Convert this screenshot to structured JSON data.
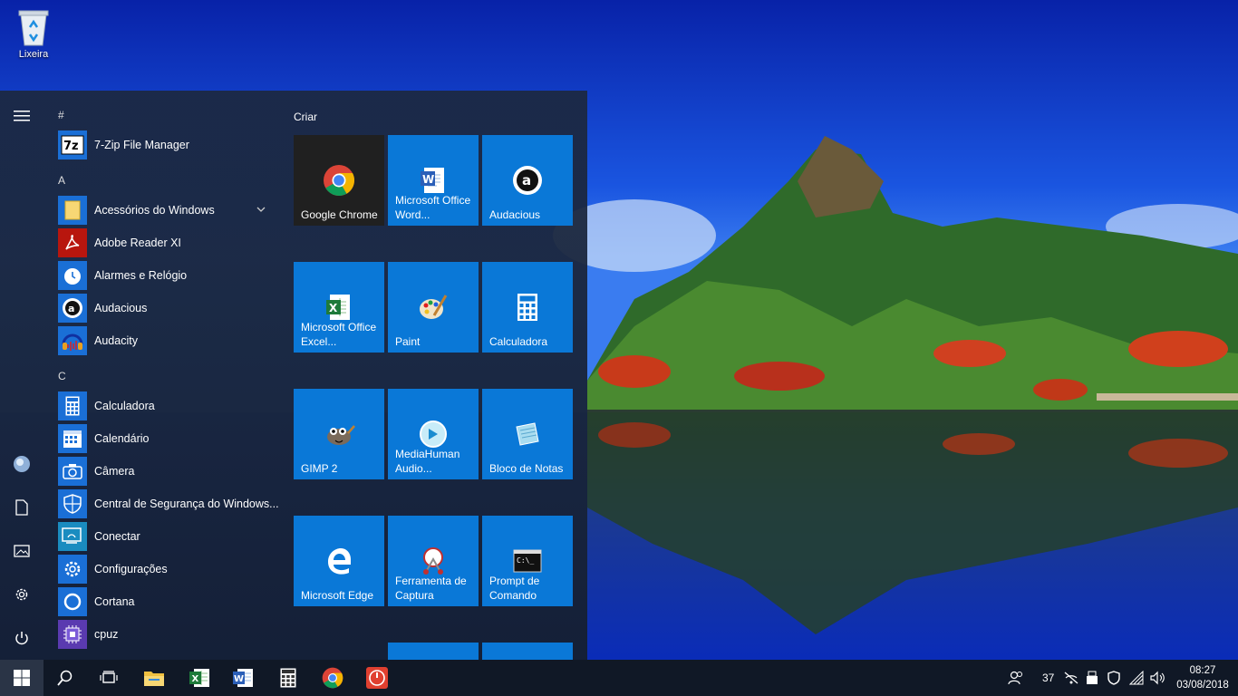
{
  "desktop": {
    "recycle_bin_label": "Lixeira"
  },
  "start_menu": {
    "tiles_header": "Criar",
    "app_list": [
      {
        "type": "group",
        "label": "#"
      },
      {
        "type": "app",
        "label": "7-Zip File Manager",
        "icon": "sevenzip-icon"
      },
      {
        "type": "group",
        "label": "A"
      },
      {
        "type": "app",
        "label": "Acessórios do Windows",
        "icon": "folder-icon",
        "expandable": true
      },
      {
        "type": "app",
        "label": "Adobe Reader XI",
        "icon": "adobe-reader-icon"
      },
      {
        "type": "app",
        "label": "Alarmes e Relógio",
        "icon": "alarm-clock-icon"
      },
      {
        "type": "app",
        "label": "Audacious",
        "icon": "audacious-icon"
      },
      {
        "type": "app",
        "label": "Audacity",
        "icon": "audacity-icon"
      },
      {
        "type": "group",
        "label": "C"
      },
      {
        "type": "app",
        "label": "Calculadora",
        "icon": "calculator-icon"
      },
      {
        "type": "app",
        "label": "Calendário",
        "icon": "calendar-icon"
      },
      {
        "type": "app",
        "label": "Câmera",
        "icon": "camera-icon"
      },
      {
        "type": "app",
        "label": "Central de Segurança do Windows...",
        "icon": "shield-icon"
      },
      {
        "type": "app",
        "label": "Conectar",
        "icon": "connect-icon"
      },
      {
        "type": "app",
        "label": "Configurações",
        "icon": "gear-icon"
      },
      {
        "type": "app",
        "label": "Cortana",
        "icon": "cortana-icon"
      },
      {
        "type": "app",
        "label": "cpuz",
        "icon": "cpuz-icon"
      }
    ],
    "tiles": [
      {
        "label": "Google Chrome",
        "icon": "chrome-icon",
        "style": "dark"
      },
      {
        "label": "Microsoft Office Word...",
        "icon": "word-icon"
      },
      {
        "label": "Audacious",
        "icon": "audacious-icon"
      },
      {
        "label": "Microsoft Office Excel...",
        "icon": "excel-icon"
      },
      {
        "label": "Paint",
        "icon": "paint-icon"
      },
      {
        "label": "Calculadora",
        "icon": "calculator-icon"
      },
      {
        "label": "GIMP 2",
        "icon": "gimp-icon"
      },
      {
        "label": "MediaHuman Audio...",
        "icon": "mediahuman-icon"
      },
      {
        "label": "Bloco de Notas",
        "icon": "notepad-icon"
      },
      {
        "label": "Microsoft Edge",
        "icon": "edge-icon"
      },
      {
        "label": "Ferramenta de Captura",
        "icon": "snipping-tool-icon"
      },
      {
        "label": "Prompt de Comando",
        "icon": "command-prompt-icon"
      },
      {
        "label": "",
        "icon": "blank-tile"
      },
      {
        "label": "",
        "icon": "blank-tile"
      }
    ]
  },
  "taskbar": {
    "pinned": [
      "folder-icon",
      "excel-icon",
      "word-icon",
      "calculator-icon",
      "chrome-icon",
      "shutdown-app-icon"
    ],
    "tray": {
      "temperature": "37"
    },
    "clock": {
      "time": "08:27",
      "date": "03/08/2018"
    }
  },
  "colors": {
    "tile_blue": "#0a78d7",
    "taskbar": "#101826",
    "start_bg": "#1c2840"
  }
}
